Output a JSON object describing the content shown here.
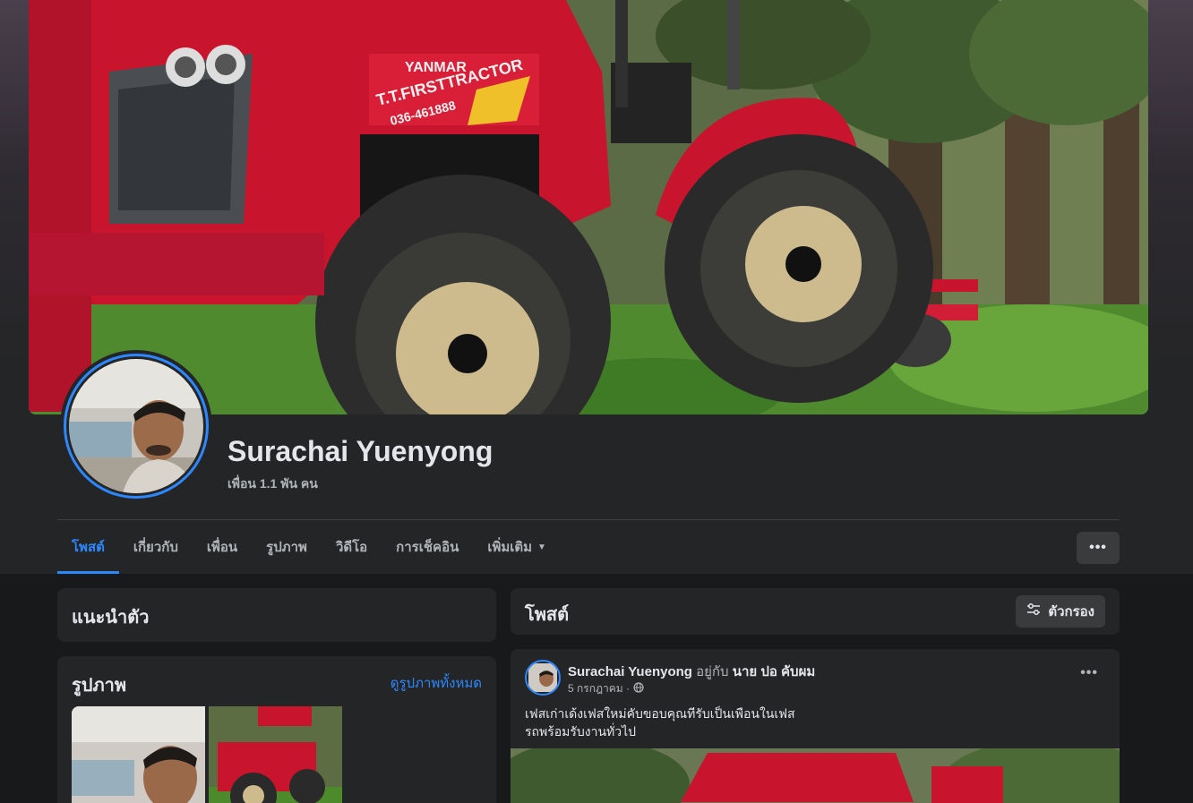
{
  "profile": {
    "name": "Surachai Yuenyong",
    "friends": "เพื่อน 1.1 พัน คน"
  },
  "tabs": [
    {
      "label": "โพสต์"
    },
    {
      "label": "เกี่ยวกับ"
    },
    {
      "label": "เพื่อน"
    },
    {
      "label": "รูปภาพ"
    },
    {
      "label": "วิดีโอ"
    },
    {
      "label": "การเช็คอิน"
    },
    {
      "label": "เพิ่มเติม"
    }
  ],
  "more_button": "•••",
  "intro": {
    "title": "แนะนำตัว"
  },
  "photos": {
    "title": "รูปภาพ",
    "see_all": "ดูรูปภาพทั้งหมด"
  },
  "posts": {
    "title": "โพสต์",
    "filter_label": "ตัวกรอง"
  },
  "post": {
    "author": "Surachai Yuenyong",
    "with_text": "อยู่กับ",
    "tagged": "นาย ปอ คับผม",
    "date": "5 กรกฎาคม ·",
    "dots": "•••",
    "line1": "เฟสเก่าเด้งเฟสใหม่คับขอบคุณทีรับเป็นเพือนในเฟส",
    "line2": "รถพร้อมรับงานทั่วไป"
  },
  "cover_text": {
    "brand": "YANMAR",
    "dealer": "T.T.FIRSTTRACTOR",
    "phone": "036-461888"
  },
  "colors": {
    "accent": "#2d88ff",
    "tractor_red": "#c8142c",
    "background": "#18191a",
    "card": "#242526"
  }
}
